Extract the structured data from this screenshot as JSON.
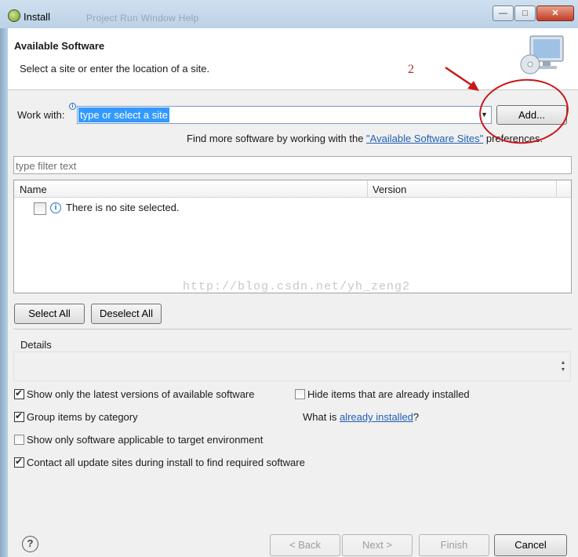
{
  "window": {
    "title": "Install",
    "ghost_menu": "Project  Run  Window  Help"
  },
  "window_controls": {
    "minimize": "—",
    "maximize": "□",
    "close": "✕"
  },
  "header": {
    "title": "Available Software",
    "description": "Select a site or enter the location of a site.",
    "annotation_number": "2"
  },
  "work_with": {
    "label": "Work with:",
    "value": "type or select a site",
    "add_button": "Add...",
    "hint_prefix": "Find more software by working with the ",
    "hint_link": "\"Available Software Sites\"",
    "hint_suffix": " preferences."
  },
  "filter": {
    "placeholder": "type filter text"
  },
  "table": {
    "columns": [
      "Name",
      "Version"
    ],
    "rows": [
      {
        "name": "There is no site selected.",
        "checked": false
      }
    ]
  },
  "watermark": "http://blog.csdn.net/yh_zeng2",
  "selection_buttons": {
    "select_all": "Select All",
    "deselect_all": "Deselect All"
  },
  "details": {
    "label": "Details"
  },
  "options": {
    "latest_versions": {
      "label": "Show only the latest versions of available software",
      "checked": true
    },
    "hide_installed": {
      "label": "Hide items that are already installed",
      "checked": false
    },
    "group_by_category": {
      "label": "Group items by category",
      "checked": true
    },
    "what_is_prefix": "What is ",
    "what_is_link": "already installed",
    "what_is_suffix": "?",
    "target_env": {
      "label": "Show only software applicable to target environment",
      "checked": false
    },
    "contact_sites": {
      "label": "Contact all update sites during install to find required software",
      "checked": true
    }
  },
  "footer": {
    "help": "?",
    "back": "< Back",
    "next": "Next >",
    "finish": "Finish",
    "cancel": "Cancel"
  },
  "colors": {
    "selection": "#3399ff",
    "link": "#1f5fb4",
    "annotation_red": "#c8181c"
  }
}
